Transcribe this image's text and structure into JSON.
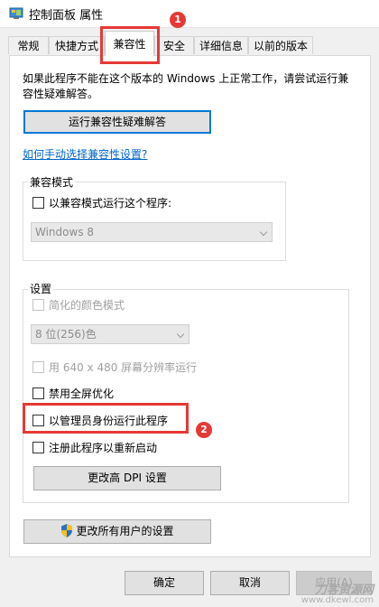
{
  "window": {
    "title": "控制面板 属性"
  },
  "tabs": [
    {
      "label": "常规"
    },
    {
      "label": "快捷方式"
    },
    {
      "label": "兼容性",
      "active": true
    },
    {
      "label": "安全"
    },
    {
      "label": "详细信息"
    },
    {
      "label": "以前的版本"
    }
  ],
  "compat": {
    "intro": "如果此程序不能在这个版本的 Windows 上正常工作，请尝试运行兼容性疑难解答。",
    "troubleshoot_button": "运行兼容性疑难解答",
    "manual_link": "如何手动选择兼容性设置?",
    "mode_group": {
      "title": "兼容模式",
      "checkbox": "以兼容模式运行这个程序:",
      "os_select": "Windows 8"
    },
    "settings_group": {
      "title": "设置",
      "reduced_color": "简化的颜色模式",
      "color_select": "8 位(256)色",
      "res_640": "用 640 x 480 屏幕分辨率运行",
      "disable_fullscreen": "禁用全屏优化",
      "run_as_admin": "以管理员身份运行此程序",
      "register_restart": "注册此程序以重新启动",
      "dpi_button": "更改高 DPI 设置"
    },
    "all_users_button": "更改所有用户的设置"
  },
  "footer": {
    "ok": "确定",
    "cancel": "取消",
    "apply": "应用(A)"
  },
  "annotations": [
    {
      "label": "1"
    },
    {
      "label": "2"
    }
  ],
  "watermark": {
    "line1": "刀客资源网",
    "line2": "www.dkewl.com"
  },
  "colors": {
    "highlight": "#e53935",
    "link": "#0066cc",
    "focus": "#0078d7"
  }
}
